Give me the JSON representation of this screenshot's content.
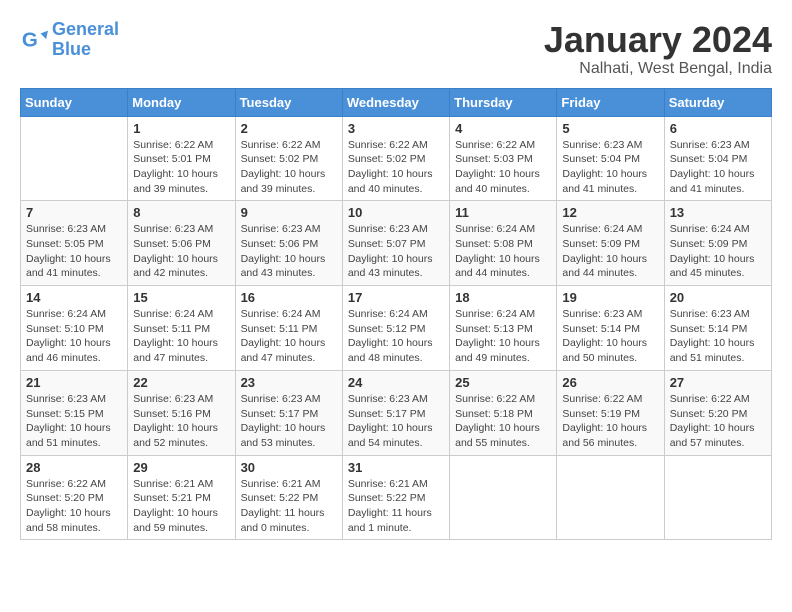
{
  "header": {
    "logo": {
      "line1": "General",
      "line2": "Blue"
    },
    "title": "January 2024",
    "subtitle": "Nalhati, West Bengal, India"
  },
  "days_of_week": [
    "Sunday",
    "Monday",
    "Tuesday",
    "Wednesday",
    "Thursday",
    "Friday",
    "Saturday"
  ],
  "weeks": [
    [
      {
        "day": "",
        "info": ""
      },
      {
        "day": "1",
        "info": "Sunrise: 6:22 AM\nSunset: 5:01 PM\nDaylight: 10 hours\nand 39 minutes."
      },
      {
        "day": "2",
        "info": "Sunrise: 6:22 AM\nSunset: 5:02 PM\nDaylight: 10 hours\nand 39 minutes."
      },
      {
        "day": "3",
        "info": "Sunrise: 6:22 AM\nSunset: 5:02 PM\nDaylight: 10 hours\nand 40 minutes."
      },
      {
        "day": "4",
        "info": "Sunrise: 6:22 AM\nSunset: 5:03 PM\nDaylight: 10 hours\nand 40 minutes."
      },
      {
        "day": "5",
        "info": "Sunrise: 6:23 AM\nSunset: 5:04 PM\nDaylight: 10 hours\nand 41 minutes."
      },
      {
        "day": "6",
        "info": "Sunrise: 6:23 AM\nSunset: 5:04 PM\nDaylight: 10 hours\nand 41 minutes."
      }
    ],
    [
      {
        "day": "7",
        "info": "Sunrise: 6:23 AM\nSunset: 5:05 PM\nDaylight: 10 hours\nand 41 minutes."
      },
      {
        "day": "8",
        "info": "Sunrise: 6:23 AM\nSunset: 5:06 PM\nDaylight: 10 hours\nand 42 minutes."
      },
      {
        "day": "9",
        "info": "Sunrise: 6:23 AM\nSunset: 5:06 PM\nDaylight: 10 hours\nand 43 minutes."
      },
      {
        "day": "10",
        "info": "Sunrise: 6:23 AM\nSunset: 5:07 PM\nDaylight: 10 hours\nand 43 minutes."
      },
      {
        "day": "11",
        "info": "Sunrise: 6:24 AM\nSunset: 5:08 PM\nDaylight: 10 hours\nand 44 minutes."
      },
      {
        "day": "12",
        "info": "Sunrise: 6:24 AM\nSunset: 5:09 PM\nDaylight: 10 hours\nand 44 minutes."
      },
      {
        "day": "13",
        "info": "Sunrise: 6:24 AM\nSunset: 5:09 PM\nDaylight: 10 hours\nand 45 minutes."
      }
    ],
    [
      {
        "day": "14",
        "info": "Sunrise: 6:24 AM\nSunset: 5:10 PM\nDaylight: 10 hours\nand 46 minutes."
      },
      {
        "day": "15",
        "info": "Sunrise: 6:24 AM\nSunset: 5:11 PM\nDaylight: 10 hours\nand 47 minutes."
      },
      {
        "day": "16",
        "info": "Sunrise: 6:24 AM\nSunset: 5:11 PM\nDaylight: 10 hours\nand 47 minutes."
      },
      {
        "day": "17",
        "info": "Sunrise: 6:24 AM\nSunset: 5:12 PM\nDaylight: 10 hours\nand 48 minutes."
      },
      {
        "day": "18",
        "info": "Sunrise: 6:24 AM\nSunset: 5:13 PM\nDaylight: 10 hours\nand 49 minutes."
      },
      {
        "day": "19",
        "info": "Sunrise: 6:23 AM\nSunset: 5:14 PM\nDaylight: 10 hours\nand 50 minutes."
      },
      {
        "day": "20",
        "info": "Sunrise: 6:23 AM\nSunset: 5:14 PM\nDaylight: 10 hours\nand 51 minutes."
      }
    ],
    [
      {
        "day": "21",
        "info": "Sunrise: 6:23 AM\nSunset: 5:15 PM\nDaylight: 10 hours\nand 51 minutes."
      },
      {
        "day": "22",
        "info": "Sunrise: 6:23 AM\nSunset: 5:16 PM\nDaylight: 10 hours\nand 52 minutes."
      },
      {
        "day": "23",
        "info": "Sunrise: 6:23 AM\nSunset: 5:17 PM\nDaylight: 10 hours\nand 53 minutes."
      },
      {
        "day": "24",
        "info": "Sunrise: 6:23 AM\nSunset: 5:17 PM\nDaylight: 10 hours\nand 54 minutes."
      },
      {
        "day": "25",
        "info": "Sunrise: 6:22 AM\nSunset: 5:18 PM\nDaylight: 10 hours\nand 55 minutes."
      },
      {
        "day": "26",
        "info": "Sunrise: 6:22 AM\nSunset: 5:19 PM\nDaylight: 10 hours\nand 56 minutes."
      },
      {
        "day": "27",
        "info": "Sunrise: 6:22 AM\nSunset: 5:20 PM\nDaylight: 10 hours\nand 57 minutes."
      }
    ],
    [
      {
        "day": "28",
        "info": "Sunrise: 6:22 AM\nSunset: 5:20 PM\nDaylight: 10 hours\nand 58 minutes."
      },
      {
        "day": "29",
        "info": "Sunrise: 6:21 AM\nSunset: 5:21 PM\nDaylight: 10 hours\nand 59 minutes."
      },
      {
        "day": "30",
        "info": "Sunrise: 6:21 AM\nSunset: 5:22 PM\nDaylight: 11 hours\nand 0 minutes."
      },
      {
        "day": "31",
        "info": "Sunrise: 6:21 AM\nSunset: 5:22 PM\nDaylight: 11 hours\nand 1 minute."
      },
      {
        "day": "",
        "info": ""
      },
      {
        "day": "",
        "info": ""
      },
      {
        "day": "",
        "info": ""
      }
    ]
  ]
}
